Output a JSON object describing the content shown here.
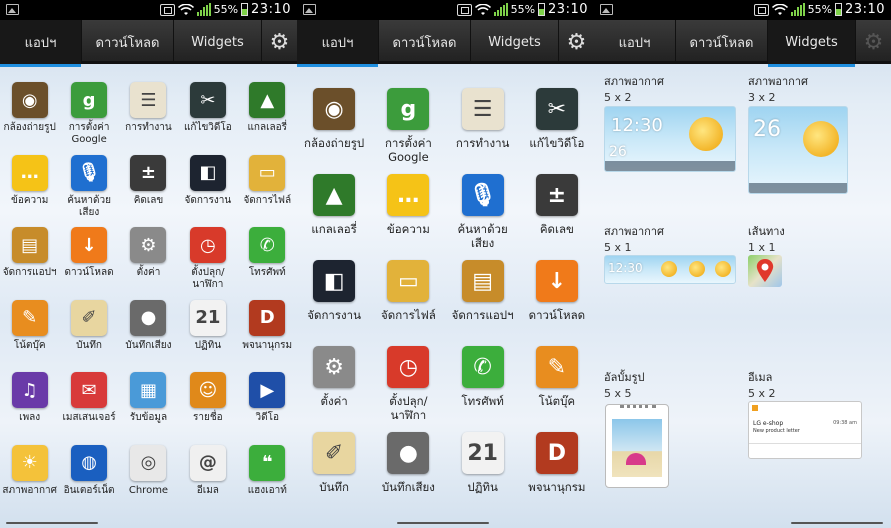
{
  "status_bar": {
    "battery": "55%",
    "time": "23:10"
  },
  "tabs": {
    "apps": "แอปฯ",
    "downloads": "ดาวน์โหลด",
    "widgets": "Widgets"
  },
  "page1": {
    "apps": [
      {
        "label": "กล้องถ่ายรูป",
        "icon": "camera-icon",
        "color": "#6b4f2a"
      },
      {
        "label": "การตั้งค่า Google",
        "icon": "google-settings-icon",
        "color": "#3c9c3c"
      },
      {
        "label": "การทำงาน",
        "icon": "tasks-icon",
        "color": "#e9e2cf"
      },
      {
        "label": "แก้ไขวิดีโอ",
        "icon": "video-editor-icon",
        "color": "#2c3a3a"
      },
      {
        "label": "แกลเลอรี่",
        "icon": "gallery-icon",
        "color": "#2f7a2a"
      },
      {
        "label": "ข้อความ",
        "icon": "messaging-icon",
        "color": "#f5c317"
      },
      {
        "label": "ค้นหาด้วยเสียง",
        "icon": "voice-search-icon",
        "color": "#1f6fd0"
      },
      {
        "label": "คิดเลข",
        "icon": "calculator-icon",
        "color": "#3a3a3a"
      },
      {
        "label": "จัดการงาน",
        "icon": "task-manager-icon",
        "color": "#1d2430"
      },
      {
        "label": "จัดการไฟล์",
        "icon": "file-manager-icon",
        "color": "#e2b23a"
      },
      {
        "label": "จัดการแอปฯ",
        "icon": "app-manager-icon",
        "color": "#c78c2a"
      },
      {
        "label": "ดาวน์โหลด",
        "icon": "download-icon",
        "color": "#f07a1a"
      },
      {
        "label": "ตั้งค่า",
        "icon": "settings-gear-icon",
        "color": "#8a8a8a"
      },
      {
        "label": "ตั้งปลุก/นาฬิกา",
        "icon": "alarm-clock-icon",
        "color": "#d83a2a"
      },
      {
        "label": "โทรศัพท์",
        "icon": "phone-icon",
        "color": "#3cae3c"
      },
      {
        "label": "โน้ตบุ๊ค",
        "icon": "notebook-icon",
        "color": "#e88d1f"
      },
      {
        "label": "บันทึก",
        "icon": "memo-icon",
        "color": "#e8d6a0"
      },
      {
        "label": "บันทึกเสียง",
        "icon": "voice-recorder-icon",
        "color": "#6a6a6a"
      },
      {
        "label": "ปฏิทิน",
        "icon": "calendar-icon",
        "color": "#f2f2f2"
      },
      {
        "label": "พจนานุกรม",
        "icon": "dictionary-icon",
        "color": "#b23a1f"
      },
      {
        "label": "เพลง",
        "icon": "music-icon",
        "color": "#6a3aa8"
      },
      {
        "label": "เมสเสนเจอร์",
        "icon": "messenger-icon",
        "color": "#d83a3a"
      },
      {
        "label": "รับข้อมูล",
        "icon": "news-icon",
        "color": "#4a9ad8"
      },
      {
        "label": "รายชื่อ",
        "icon": "contacts-icon",
        "color": "#e0891a"
      },
      {
        "label": "วิดีโอ",
        "icon": "video-icon",
        "color": "#1f4fa8"
      },
      {
        "label": "สภาพอากาศ",
        "icon": "weather-icon",
        "color": "#f4c23a"
      },
      {
        "label": "อินเตอร์เน็ต",
        "icon": "browser-icon",
        "color": "#1a5fc0"
      },
      {
        "label": "Chrome",
        "icon": "chrome-icon",
        "color": "#e8e8e8"
      },
      {
        "label": "อีเมล",
        "icon": "email-icon",
        "color": "#f0f0f0"
      },
      {
        "label": "แฮงเอาท์",
        "icon": "hangouts-icon",
        "color": "#3cae3c"
      }
    ]
  },
  "page2": {
    "apps": [
      {
        "label": "กล้องถ่ายรูป",
        "icon": "camera-icon",
        "color": "#6b4f2a"
      },
      {
        "label": "การตั้งค่า Google",
        "icon": "google-settings-icon",
        "color": "#3c9c3c"
      },
      {
        "label": "การทำงาน",
        "icon": "tasks-icon",
        "color": "#e9e2cf"
      },
      {
        "label": "แก้ไขวิดีโอ",
        "icon": "video-editor-icon",
        "color": "#2c3a3a"
      },
      {
        "label": "แกลเลอรี่",
        "icon": "gallery-icon",
        "color": "#2f7a2a"
      },
      {
        "label": "ข้อความ",
        "icon": "messaging-icon",
        "color": "#f5c317"
      },
      {
        "label": "ค้นหาด้วยเสียง",
        "icon": "voice-search-icon",
        "color": "#1f6fd0"
      },
      {
        "label": "คิดเลข",
        "icon": "calculator-icon",
        "color": "#3a3a3a"
      },
      {
        "label": "จัดการงาน",
        "icon": "task-manager-icon",
        "color": "#1d2430"
      },
      {
        "label": "จัดการไฟล์",
        "icon": "file-manager-icon",
        "color": "#e2b23a"
      },
      {
        "label": "จัดการแอปฯ",
        "icon": "app-manager-icon",
        "color": "#c78c2a"
      },
      {
        "label": "ดาวน์โหลด",
        "icon": "download-icon",
        "color": "#f07a1a"
      },
      {
        "label": "ตั้งค่า",
        "icon": "settings-gear-icon",
        "color": "#8a8a8a"
      },
      {
        "label": "ตั้งปลุก/นาฬิกา",
        "icon": "alarm-clock-icon",
        "color": "#d83a2a"
      },
      {
        "label": "โทรศัพท์",
        "icon": "phone-icon",
        "color": "#3cae3c"
      },
      {
        "label": "โน้ตบุ๊ค",
        "icon": "notebook-icon",
        "color": "#e88d1f"
      },
      {
        "label": "บันทึก",
        "icon": "memo-icon",
        "color": "#e8d6a0"
      },
      {
        "label": "บันทึกเสียง",
        "icon": "voice-recorder-icon",
        "color": "#6a6a6a"
      },
      {
        "label": "ปฏิทิน",
        "icon": "calendar-icon",
        "color": "#f2f2f2"
      },
      {
        "label": "พจนานุกรม",
        "icon": "dictionary-icon",
        "color": "#b23a1f"
      }
    ]
  },
  "widgets": {
    "weather_5x2": {
      "name": "สภาพอากาศ",
      "size": "5 x 2",
      "time": "12:30",
      "temp": "26"
    },
    "weather_3x2": {
      "name": "สภาพอากาศ",
      "size": "3 x 2",
      "temp": "26"
    },
    "weather_5x1": {
      "name": "สภาพอากาศ",
      "size": "5 x 1",
      "time": "12:30"
    },
    "maps_1x1": {
      "name": "เส้นทาง",
      "size": "1 x 1"
    },
    "album_5x5": {
      "name": "อัลบั้มรูป",
      "size": "5 x 5"
    },
    "email_5x2": {
      "name": "อีเมล",
      "size": "5 x 2",
      "shop": "LG e-shop",
      "clock": "09:38 am",
      "subject": "New product letter"
    }
  }
}
